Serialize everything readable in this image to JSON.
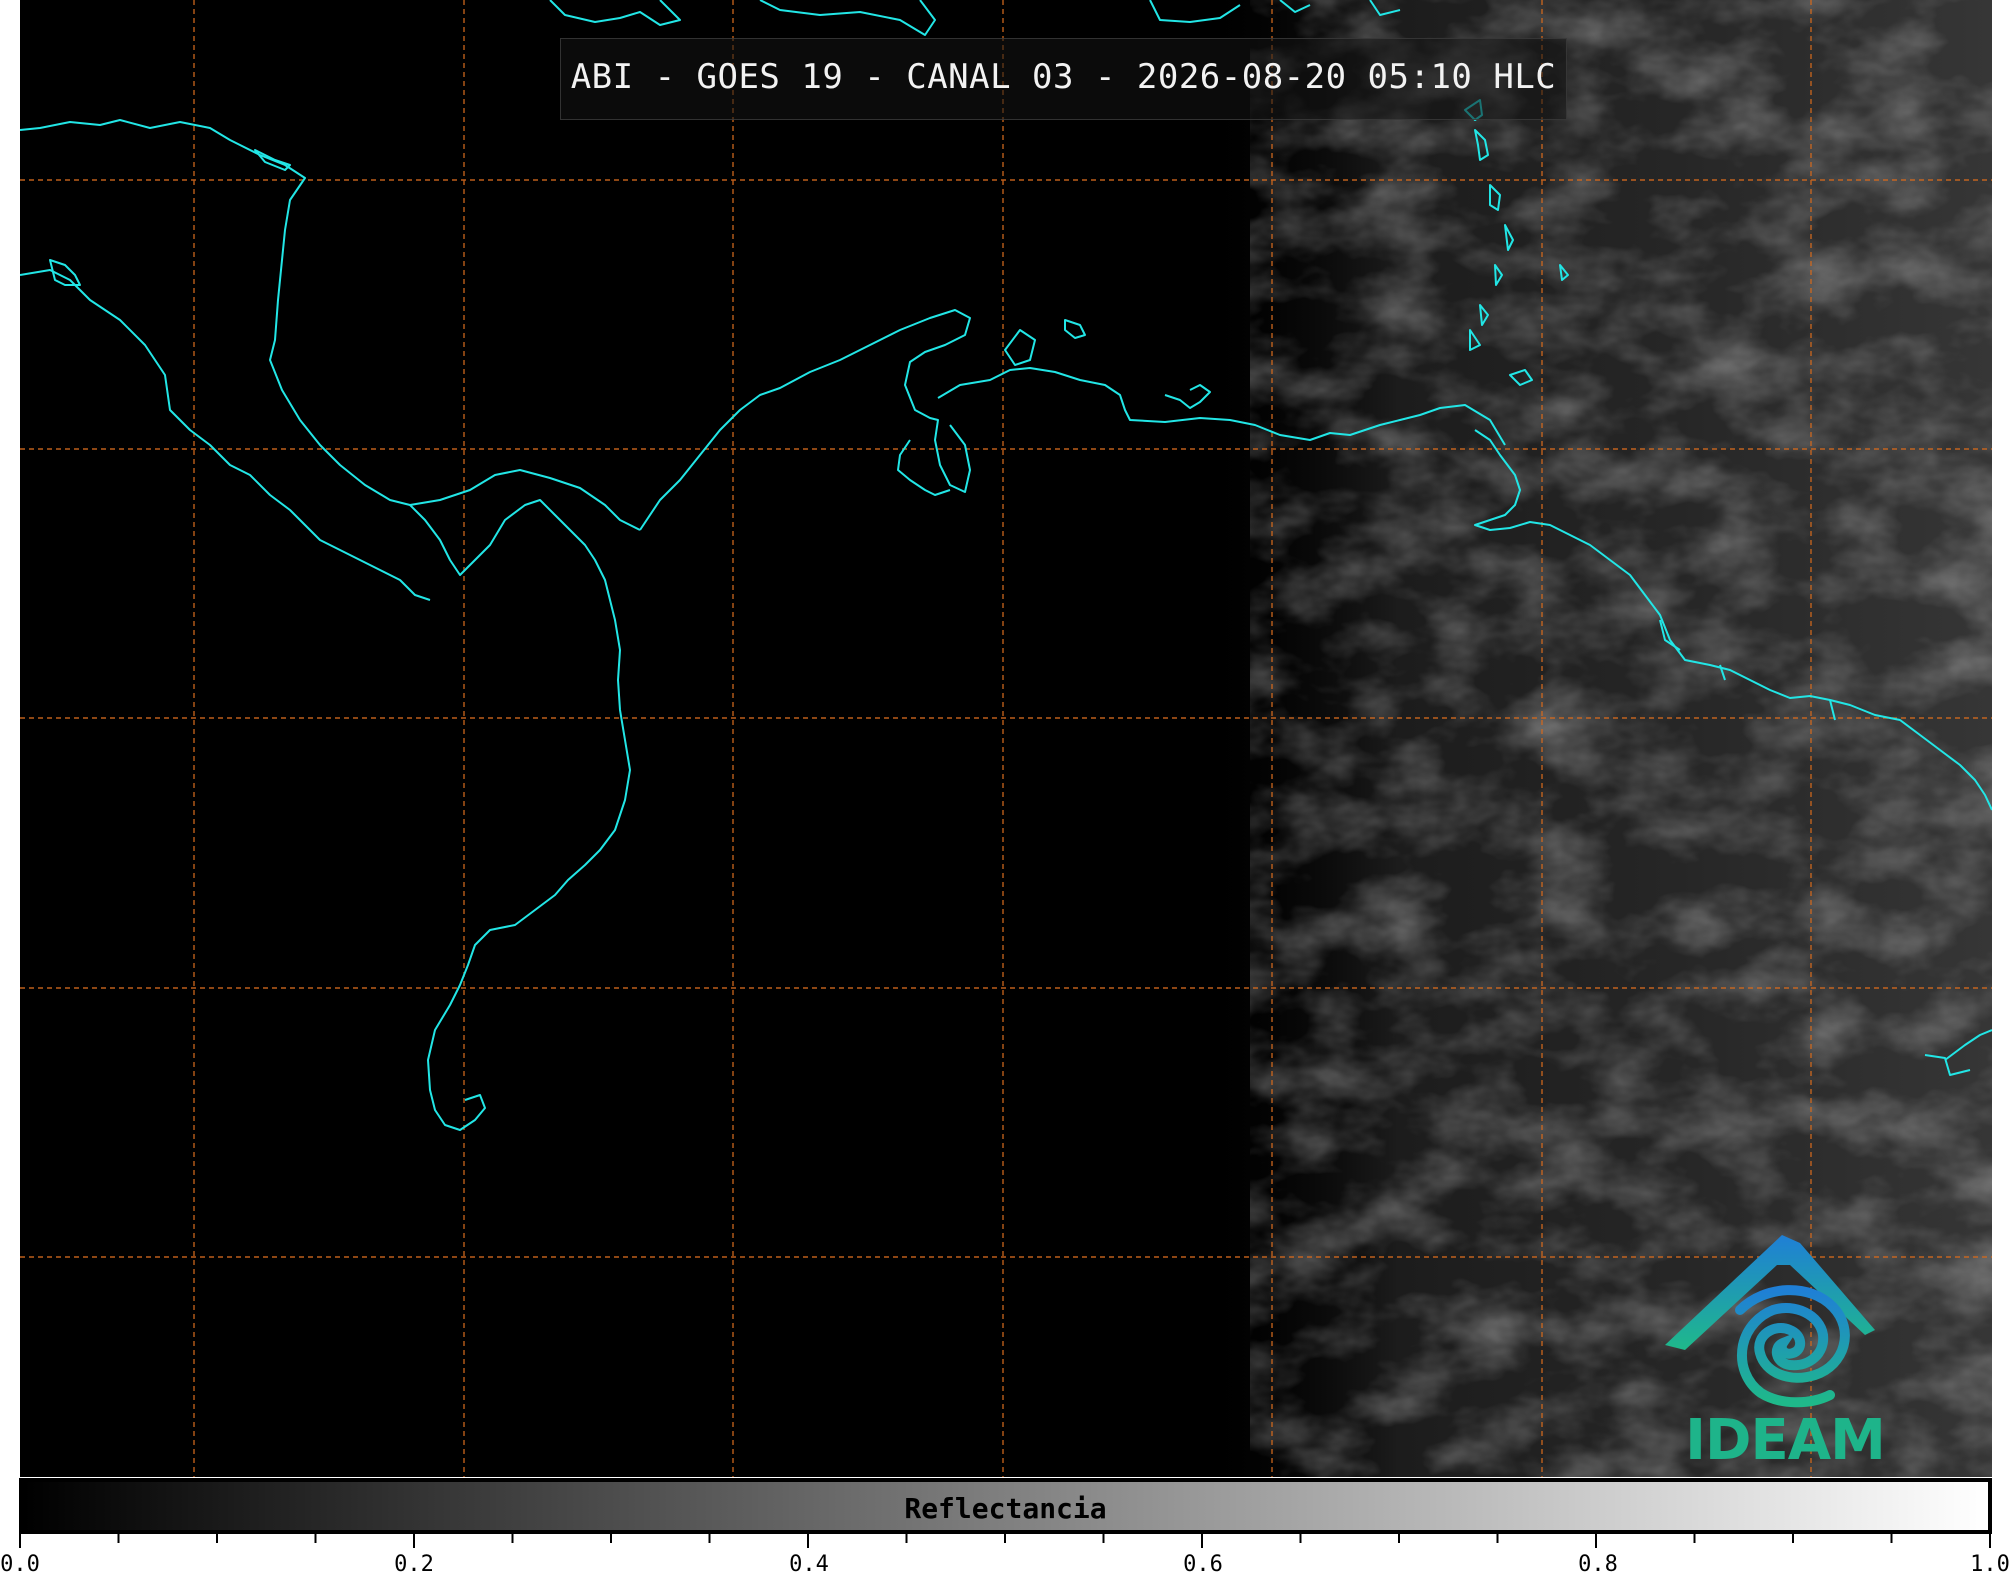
{
  "title": "ABI - GOES 19 - CANAL 03 - 2026-08-20 05:10 HLC",
  "logo": {
    "name": "IDEAM",
    "icon": "ideam-logo-icon"
  },
  "colorbar": {
    "label": "Reflectancia",
    "ticks": [
      "0.0",
      "0.2",
      "0.4",
      "0.6",
      "0.8",
      "1.0"
    ],
    "range": [
      0.0,
      1.0
    ],
    "colormap": "grayscale"
  },
  "colors": {
    "coastline": "#22e6e6",
    "gridlines": "#d2691e",
    "background": "#000000"
  }
}
